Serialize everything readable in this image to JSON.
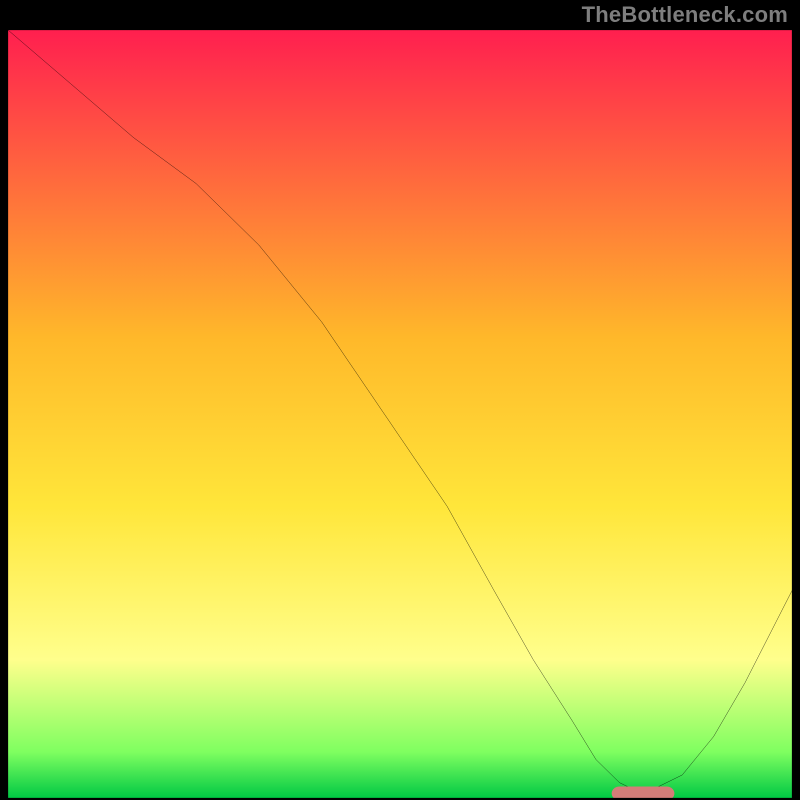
{
  "watermark": "TheBottleneck.com",
  "chart_data": {
    "type": "line",
    "title": "",
    "xlabel": "",
    "ylabel": "",
    "xlim": [
      0,
      100
    ],
    "ylim": [
      0,
      100
    ],
    "grid": false,
    "legend": "none",
    "gradient_colors": {
      "top": "#ff1f4f",
      "upper_mid": "#ffb82a",
      "mid": "#ffe63a",
      "pale_yellow": "#ffff8c",
      "low": "#7fff60",
      "bottom": "#00c844"
    },
    "series": [
      {
        "name": "curve",
        "color": "#000000",
        "x": [
          0,
          8,
          16,
          24,
          32,
          40,
          48,
          56,
          62,
          67,
          72,
          75,
          78,
          80,
          82,
          86,
          90,
          94,
          98,
          100
        ],
        "y": [
          100,
          93,
          86,
          80,
          72,
          62,
          50,
          38,
          27,
          18,
          10,
          5,
          2,
          1,
          1,
          3,
          8,
          15,
          23,
          27
        ]
      }
    ],
    "marker": {
      "name": "minimum-marker",
      "color": "#d47d78",
      "x_start": 77,
      "x_end": 85,
      "y": 0.6,
      "thickness": 1.8
    }
  }
}
